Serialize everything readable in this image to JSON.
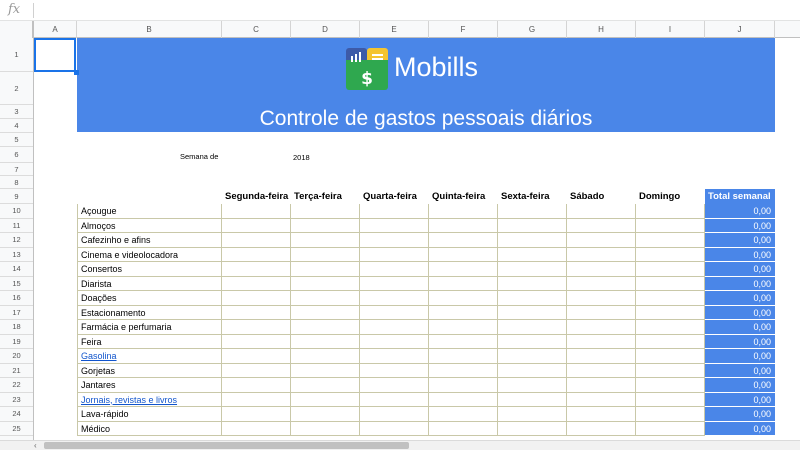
{
  "formula_bar": {
    "icon": "fx",
    "value": ""
  },
  "columns": [
    "A",
    "B",
    "C",
    "D",
    "E",
    "F",
    "G",
    "H",
    "I",
    "J"
  ],
  "rows": [
    "1",
    "2",
    "3",
    "4",
    "5",
    "6",
    "7",
    "8",
    "9",
    "10",
    "11",
    "12",
    "13",
    "14",
    "15",
    "16",
    "17",
    "18",
    "19",
    "20",
    "21",
    "22",
    "23",
    "24",
    "25"
  ],
  "banner": {
    "logo_text": "Mobills",
    "title": "Controle de gastos pessoais diários",
    "color": "#4a86e8"
  },
  "week": {
    "label": "Semana de",
    "year": "2018"
  },
  "headers": [
    "Segunda-feira",
    "Terça-feira",
    "Quarta-feira",
    "Quinta-feira",
    "Sexta-feira",
    "Sábado",
    "Domingo"
  ],
  "total_header": "Total semanal",
  "items": [
    {
      "label": "Açougue",
      "total": "0,00",
      "link": false
    },
    {
      "label": "Almoços",
      "total": "0,00",
      "link": false
    },
    {
      "label": "Cafezinho e afins",
      "total": "0,00",
      "link": false
    },
    {
      "label": "Cinema e videolocadora",
      "total": "0,00",
      "link": false
    },
    {
      "label": "Consertos",
      "total": "0,00",
      "link": false
    },
    {
      "label": "Diarista",
      "total": "0,00",
      "link": false
    },
    {
      "label": "Doações",
      "total": "0,00",
      "link": false
    },
    {
      "label": "Estacionamento",
      "total": "0,00",
      "link": false
    },
    {
      "label": "Farmácia e perfumaria",
      "total": "0,00",
      "link": false
    },
    {
      "label": "Feira",
      "total": "0,00",
      "link": false
    },
    {
      "label": "Gasolina",
      "total": "0,00",
      "link": true
    },
    {
      "label": "Gorjetas",
      "total": "0,00",
      "link": false
    },
    {
      "label": "Jantares",
      "total": "0,00",
      "link": false
    },
    {
      "label": "Jornais, revistas e livros",
      "total": "0,00",
      "link": true
    },
    {
      "label": "Lava-rápido",
      "total": "0,00",
      "link": false
    },
    {
      "label": "Médico",
      "total": "0,00",
      "link": false
    }
  ],
  "hscroll": {
    "left_arrow": "‹"
  }
}
